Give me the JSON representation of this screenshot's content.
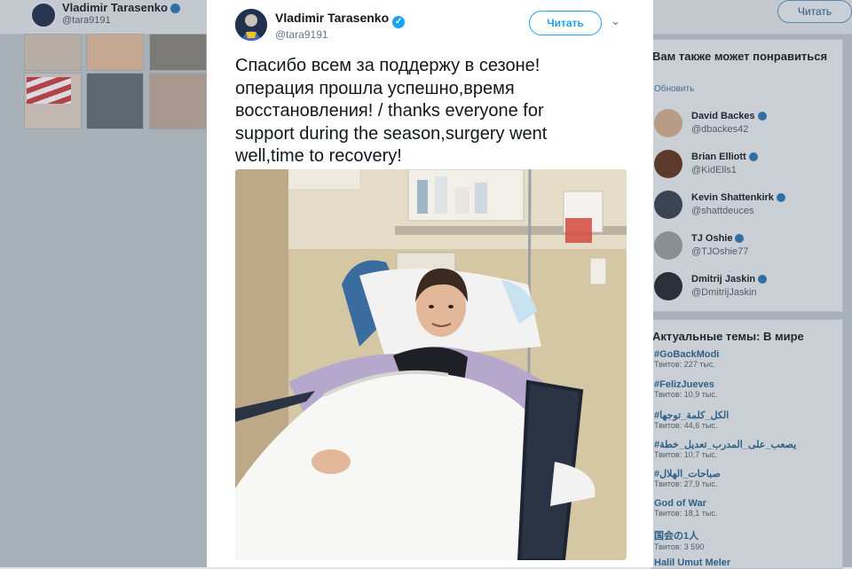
{
  "background": {
    "profile_name": "Vladimir Tarasenko",
    "profile_handle": "@tara9191",
    "follow_label": "Читать"
  },
  "tweet": {
    "author_name": "Vladimir Tarasenko",
    "author_handle": "@tara9191",
    "follow_label": "Читать",
    "text_line1": "Спасибо всем за поддержу в сезоне!",
    "text_line2": "операция прошла успешно,время",
    "text_line3": "восстановления! / thanks everyone for",
    "text_line4": "support during the season,surgery went",
    "text_line5": "well,time to recovery!",
    "media_icon": "hospital-photo",
    "verified_icon": "verified-badge-icon",
    "menu_icon": "chevron-down-icon"
  },
  "sidebar": {
    "who_to_follow_title": "Вам также может понравиться",
    "refresh_label": "Обновить",
    "suggestions": [
      {
        "name": "David Backes",
        "handle": "@dbackes42"
      },
      {
        "name": "Brian Elliott",
        "handle": "@KidElls1"
      },
      {
        "name": "Kevin Shattenkirk",
        "handle": "@shattdeuces"
      },
      {
        "name": "TJ Oshie",
        "handle": "@TJOshie77"
      },
      {
        "name": "Dmitrij Jaskin",
        "handle": "@DmitrijJaskin"
      }
    ],
    "trends_title": "Актуальные темы: В мире",
    "trends": [
      {
        "name": "#GoBackModi",
        "count": "Твитов: 227 тыс."
      },
      {
        "name": "#FelizJueves",
        "count": "Твитов: 10,9 тыс."
      },
      {
        "name": "#الكل_كلمة_توجها",
        "count": "Твитов: 44,6 тыс."
      },
      {
        "name": "#يصعب_على_المدرب_تعديل_خطة",
        "count": "Твитов: 10,7 тыс."
      },
      {
        "name": "#صباحات_الهلال",
        "count": "Твитов: 27,9 тыс."
      },
      {
        "name": "God of War",
        "count": "Твитов: 18,1 тыс."
      },
      {
        "name": "国会の1人",
        "count": "Твитов: 3 590"
      },
      {
        "name": "Halil Umut Meler",
        "count": ""
      }
    ]
  },
  "colors": {
    "accent": "#1da1f2",
    "overlay": "#a8b0b8",
    "text": "#14171a"
  }
}
